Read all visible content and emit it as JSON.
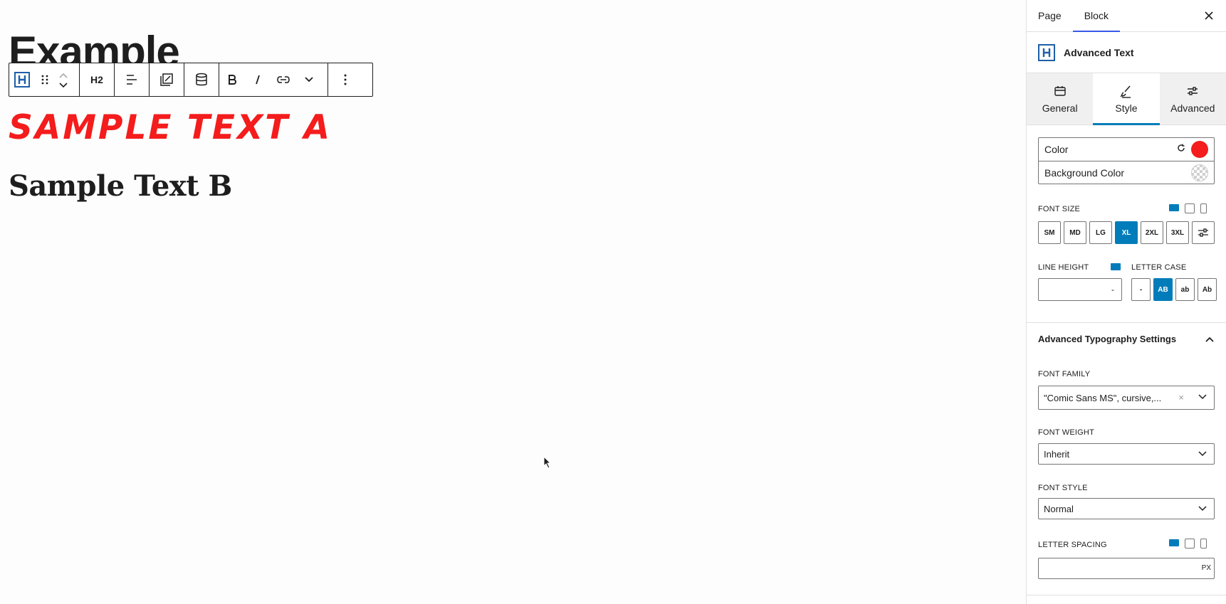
{
  "canvas": {
    "heading_text": "Example",
    "sample_a": "SAMPLE TEXT A",
    "sample_b": "Sample Text B"
  },
  "toolbar": {
    "heading_level": "H2",
    "more_label": "⋮"
  },
  "sidebar": {
    "tabs": [
      {
        "label": "Page"
      },
      {
        "label": "Block"
      }
    ],
    "active_tab": "Block",
    "block_name": "Advanced Text",
    "panel_tabs": [
      {
        "label": "General",
        "icon": "calendar-icon"
      },
      {
        "label": "Style",
        "icon": "brush-icon"
      },
      {
        "label": "Advanced",
        "icon": "sliders-icon"
      }
    ],
    "active_panel_tab": "Style",
    "colors": {
      "color_label": "Color",
      "color_value": "#f41c1c",
      "background_label": "Background Color"
    },
    "font_size": {
      "label": "FONT SIZE",
      "options": [
        "SM",
        "MD",
        "LG",
        "XL",
        "2XL",
        "3XL"
      ],
      "selected": "XL"
    },
    "line_height": {
      "label": "LINE HEIGHT",
      "value": "-"
    },
    "letter_case": {
      "label": "LETTER CASE",
      "options": [
        "-",
        "AB",
        "ab",
        "Ab"
      ],
      "selected": "AB"
    },
    "advanced_typography": {
      "title": "Advanced Typography Settings",
      "font_family_label": "FONT FAMILY",
      "font_family_value": "\"Comic Sans MS\", cursive,...",
      "font_weight_label": "FONT WEIGHT",
      "font_weight_value": "Inherit",
      "font_style_label": "FONT STYLE",
      "font_style_value": "Normal",
      "letter_spacing_label": "LETTER SPACING",
      "letter_spacing_unit": "PX"
    }
  },
  "accent_color": "#007cba"
}
